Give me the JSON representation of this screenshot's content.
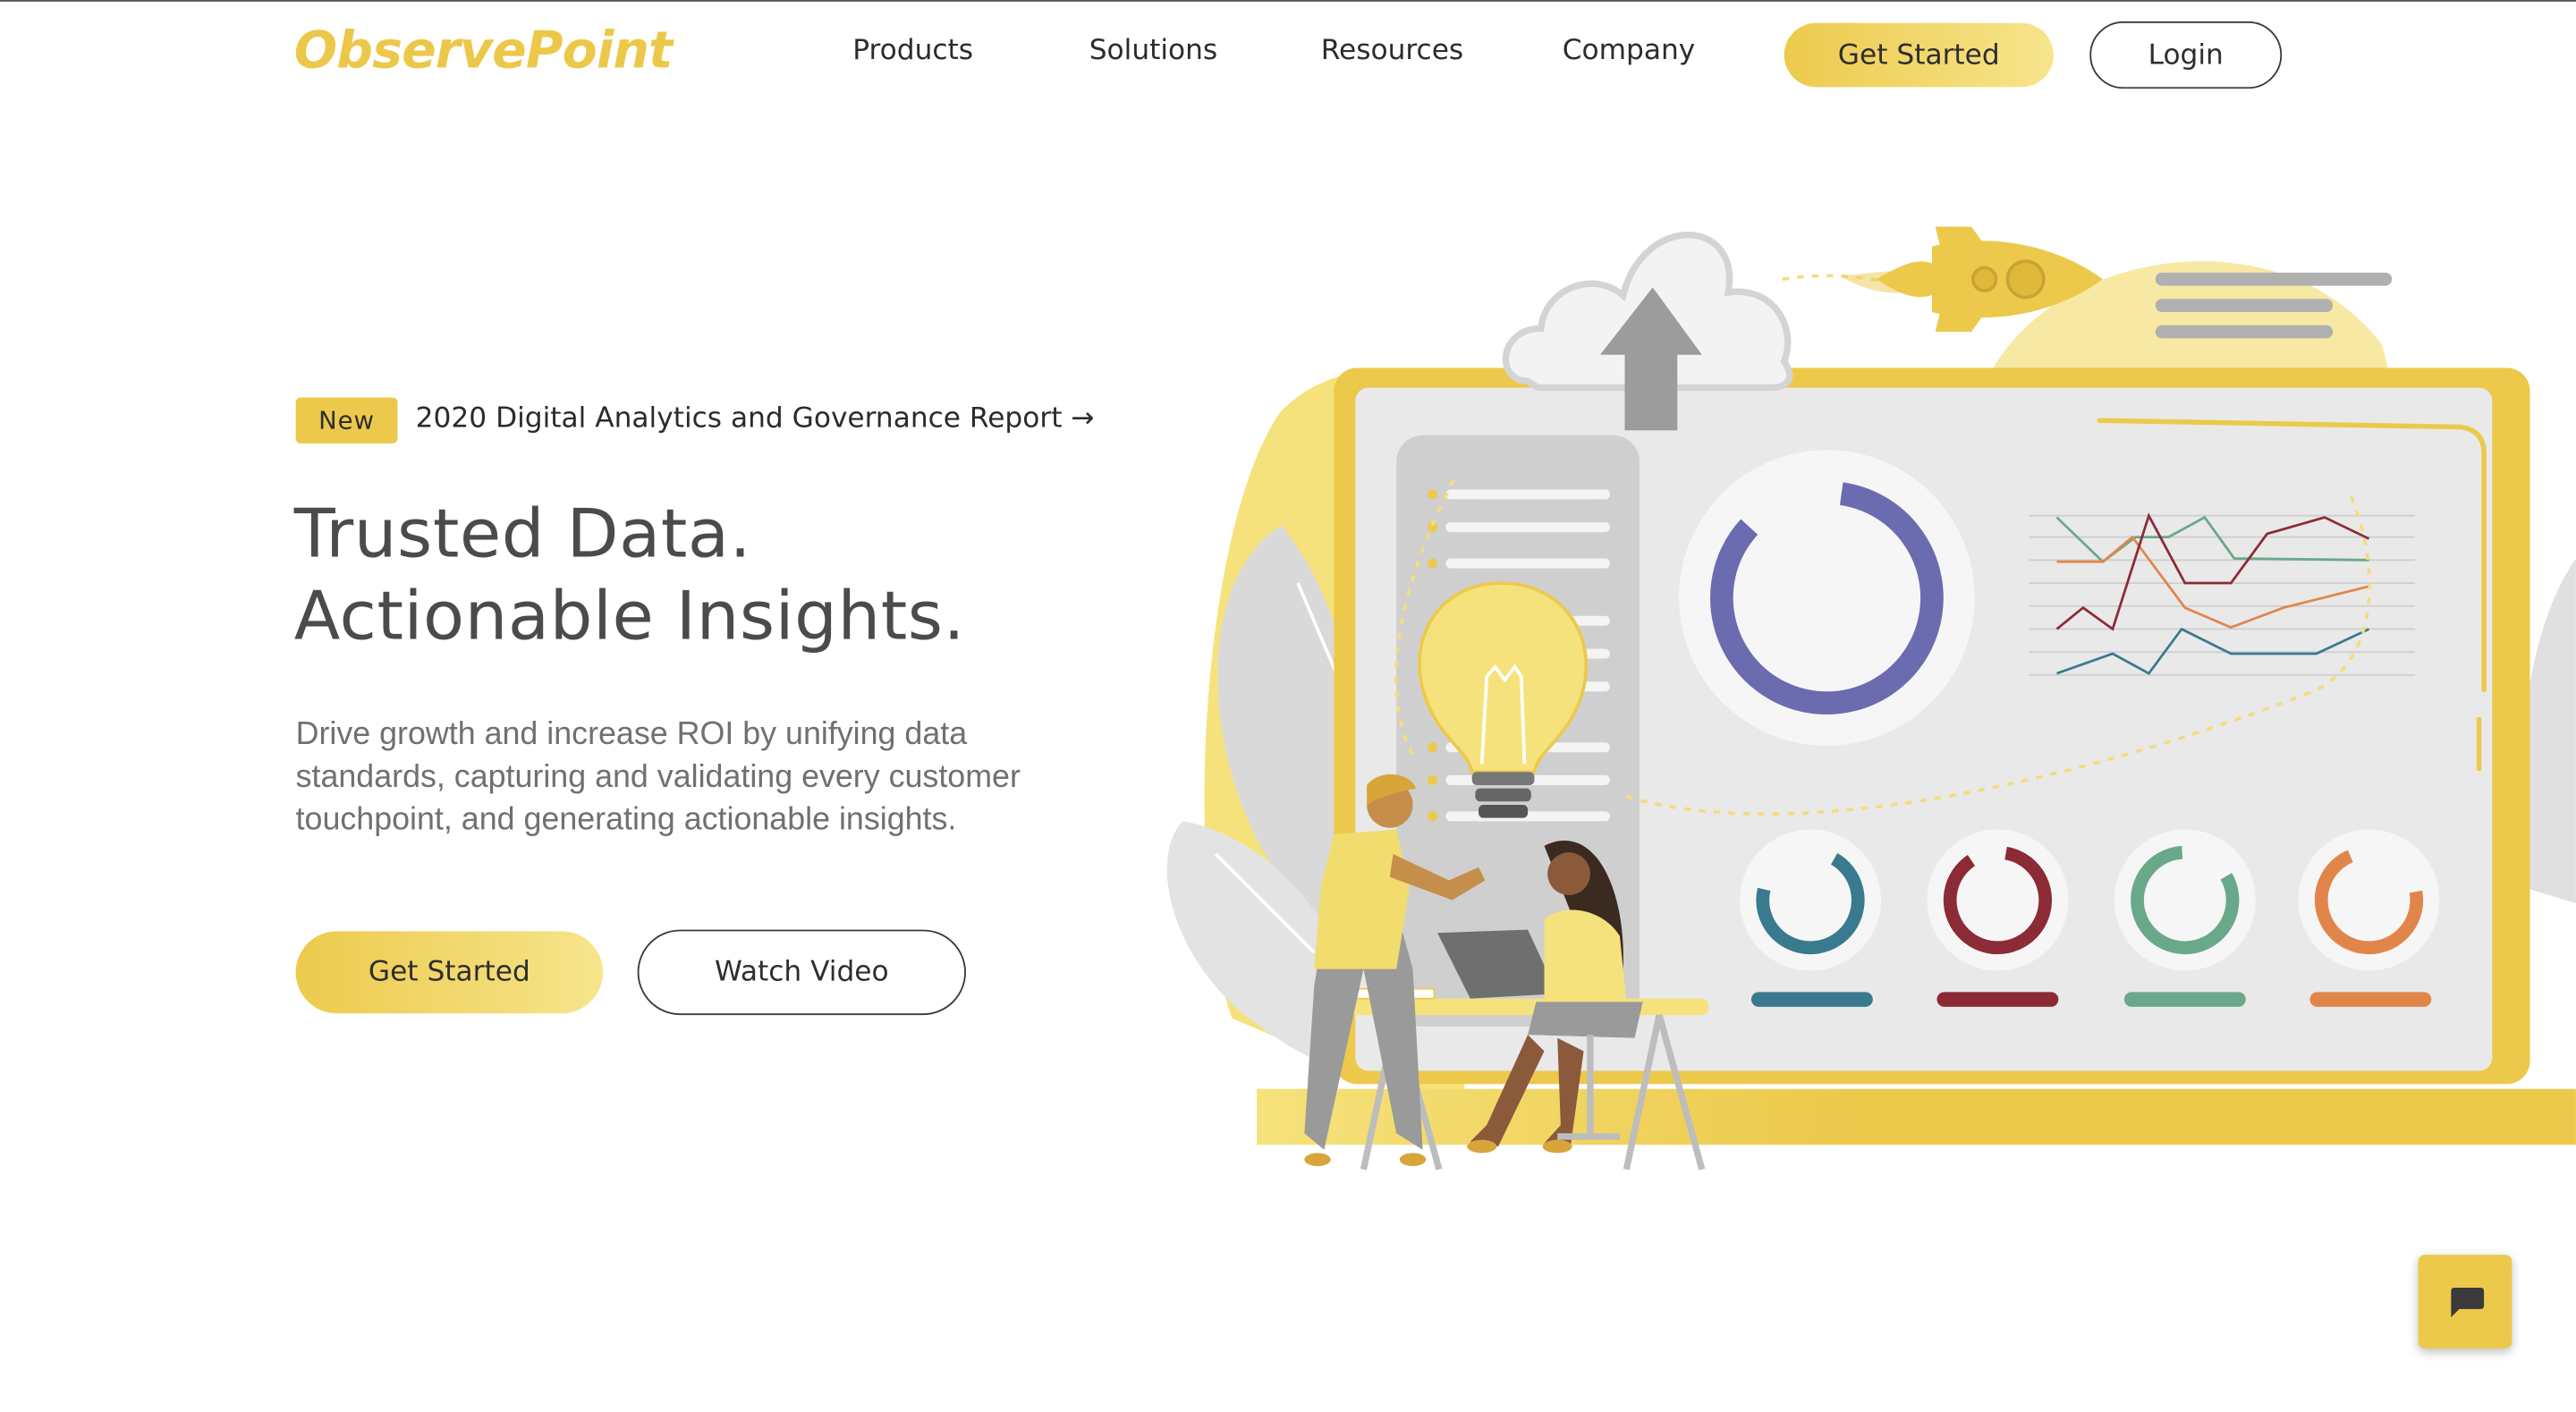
{
  "brand": {
    "logo_text": "ObservePoint",
    "accent": "#ecc94b"
  },
  "nav": {
    "links": [
      "Products",
      "Solutions",
      "Resources",
      "Company"
    ],
    "get_started": "Get Started",
    "login": "Login"
  },
  "hero": {
    "badge": "New",
    "report_link": "2020 Digital Analytics and Governance Report →",
    "headline_line1": "Trusted Data.",
    "headline_line2": "Actionable Insights.",
    "description": "Drive growth and increase ROI by unifying data standards, capturing and validating every customer touchpoint, and generating actionable insights.",
    "primary_button": "Get Started",
    "secondary_button": "Watch Video"
  },
  "illustration": {
    "donut_colors": [
      "#3a7a8e",
      "#8c2a36",
      "#6aa88a",
      "#e2854a"
    ],
    "main_donut_color": "#6b6bb0",
    "icons": [
      "cloud-upload-icon",
      "rocket-icon",
      "lightbulb-icon"
    ]
  },
  "chat": {
    "icon": "chat-icon"
  }
}
